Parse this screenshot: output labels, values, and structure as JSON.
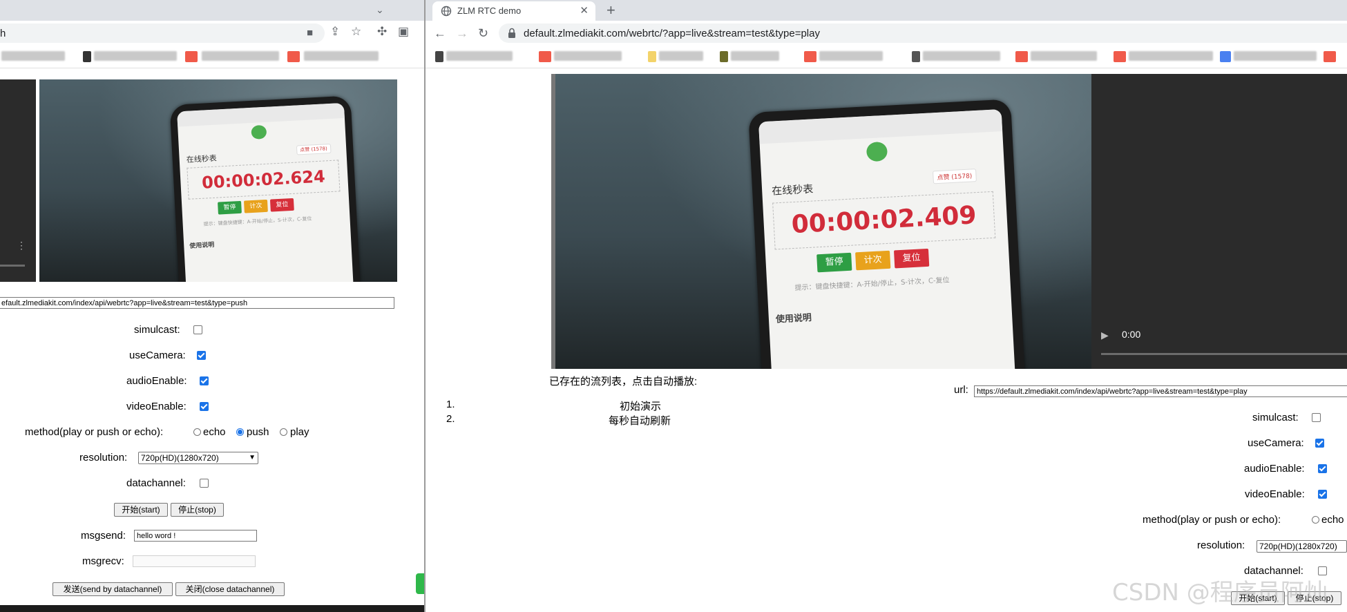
{
  "left_window": {
    "omnibox_text": "h",
    "video": {
      "timer": "00:00:02.624",
      "app_title": "在线秒表",
      "like_label": "点赞 (1578)",
      "btn_pause": "暂停",
      "btn_lap": "计次",
      "btn_reset": "复位",
      "tip": "提示：键盘快捷键：A-开始/停止，S-计次，C-复位",
      "usage": "使用说明"
    },
    "form": {
      "url_value": "efault.zlmediakit.com/index/api/webrtc?app=live&stream=test&type=push",
      "simulcast_label": "simulcast:",
      "simulcast_checked": false,
      "useCamera_label": "useCamera:",
      "useCamera_checked": true,
      "audioEnable_label": "audioEnable:",
      "audioEnable_checked": true,
      "videoEnable_label": "videoEnable:",
      "videoEnable_checked": true,
      "method_label": "method(play or push or echo):",
      "method_options": [
        "echo",
        "push",
        "play"
      ],
      "method_selected": "push",
      "resolution_label": "resolution:",
      "resolution_value": "720p(HD)(1280x720)",
      "datachannel_label": "datachannel:",
      "datachannel_checked": false,
      "start_button": "开始(start)",
      "stop_button": "停止(stop)",
      "msgsend_label": "msgsend:",
      "msgsend_value": "hello word !",
      "msgrecv_label": "msgrecv:",
      "msgrecv_value": "",
      "send_button": "发送(send by datachannel)",
      "close_button": "关闭(close datachannel)"
    }
  },
  "right_window": {
    "tab_title": "ZLM RTC demo",
    "address": "default.zlmediakit.com/webrtc/?app=live&stream=test&type=play",
    "video": {
      "timer": "00:00:02.409",
      "app_title": "在线秒表",
      "like_label": "点赞 (1578)",
      "btn_pause": "暂停",
      "btn_lap": "计次",
      "btn_reset": "复位",
      "tip": "提示：键盘快捷键：A-开始/停止，S-计次，C-复位",
      "usage": "使用说明"
    },
    "remote_video_time": "0:00",
    "stream_list_title": "已存在的流列表，点击自动播放:",
    "stream_list": [
      {
        "num": "1.",
        "label": "初始演示"
      },
      {
        "num": "2.",
        "label": "每秒自动刷新"
      }
    ],
    "form": {
      "url_label": "url:",
      "url_value": "https://default.zlmediakit.com/index/api/webrtc?app=live&stream=test&type=play",
      "simulcast_label": "simulcast:",
      "simulcast_checked": false,
      "useCamera_label": "useCamera:",
      "useCamera_checked": true,
      "audioEnable_label": "audioEnable:",
      "audioEnable_checked": true,
      "videoEnable_label": "videoEnable:",
      "videoEnable_checked": true,
      "method_label": "method(play or push or echo):",
      "method_first_option": "echo",
      "resolution_label": "resolution:",
      "resolution_value": "720p(HD)(1280x720)",
      "datachannel_label": "datachannel:",
      "datachannel_checked": false,
      "start_button": "开始(start)",
      "stop_button": "停止(stop)"
    }
  },
  "watermark": "CSDN @程序员阿灿"
}
